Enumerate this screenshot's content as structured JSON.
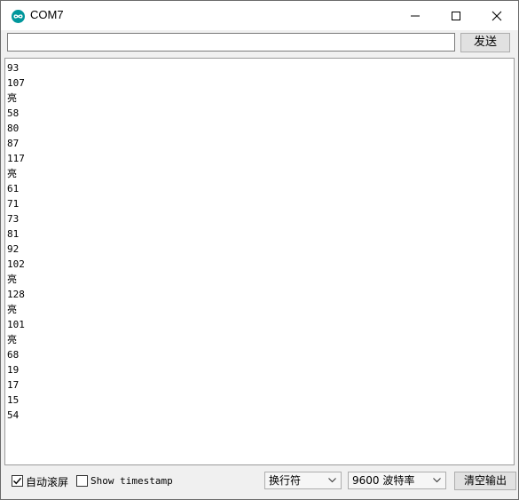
{
  "window": {
    "title": "COM7"
  },
  "icons": {
    "app": "arduino-infinity-icon",
    "minimize": "minimize-icon",
    "maximize": "maximize-icon",
    "close": "close-icon",
    "dropdown": "chevron-down-icon",
    "check": "checkmark-icon"
  },
  "colors": {
    "app_icon": "#00979c",
    "border": "#6b6b6b",
    "panel": "#f0f0f0"
  },
  "send": {
    "input_value": "",
    "button_label": "发送"
  },
  "output": {
    "lines": [
      "93",
      "107",
      "亮",
      "58",
      "80",
      "87",
      "117",
      "亮",
      "61",
      "71",
      "73",
      "81",
      "92",
      "102",
      "亮",
      "128",
      "亮",
      "101",
      "亮",
      "68",
      "19",
      "17",
      "15",
      "54"
    ]
  },
  "status": {
    "autoscroll_label": "自动滚屏",
    "autoscroll_checked": true,
    "timestamp_label": "Show timestamp",
    "timestamp_checked": false,
    "line_ending": "换行符",
    "baud_rate": "9600 波特率",
    "clear_label": "清空输出"
  }
}
